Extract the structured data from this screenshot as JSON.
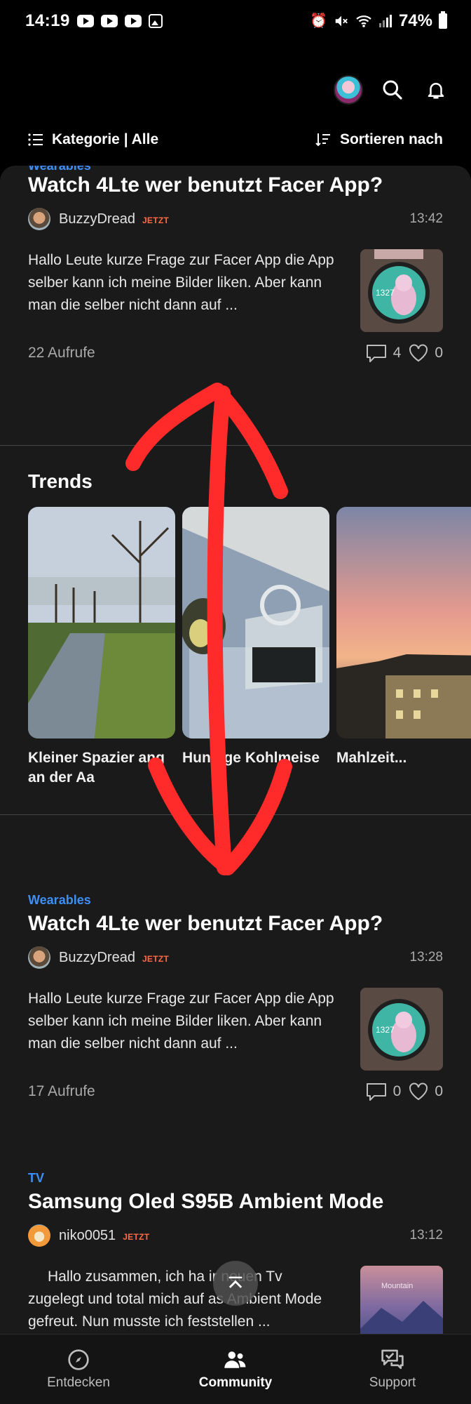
{
  "status_bar": {
    "time": "14:19",
    "battery": "74%"
  },
  "filter": {
    "category_label": "Kategorie | Alle",
    "sort_label": "Sortieren nach"
  },
  "posts": [
    {
      "category": "Wearables",
      "title": "Watch 4Lte wer benutzt Facer App?",
      "author": "BuzzyDread",
      "badge": "JETZT",
      "time": "13:42",
      "excerpt": "Hallo Leute kurze Frage zur Facer App die App selber kann ich meine Bilder liken. Aber kann man die selber nicht dann auf ...",
      "views": "22 Aufrufe",
      "comments": "4",
      "likes": "0"
    },
    {
      "category": "Wearables",
      "title": "Watch 4Lte wer benutzt Facer App?",
      "author": "BuzzyDread",
      "badge": "JETZT",
      "time": "13:28",
      "excerpt": "Hallo Leute kurze Frage zur Facer App die App selber kann ich meine Bilder liken. Aber kann man die selber nicht dann auf ...",
      "views": "17 Aufrufe",
      "comments": "0",
      "likes": "0"
    },
    {
      "category": "TV",
      "title": "Samsung Oled S95B Ambient Mode",
      "author": "niko0051",
      "badge": "JETZT",
      "time": "13:12",
      "excerpt": "Hallo zusammen, ich ha ir neuen Tv zugelegt und total mich auf as Ambient Mode gefreut. Nun musste ich feststellen ..."
    }
  ],
  "trends": {
    "title": "Trends",
    "items": [
      {
        "label": "Kleiner Spazier ang an der Aa"
      },
      {
        "label": "Hung ge Kohlmeise"
      },
      {
        "label": "Mahlzeit..."
      }
    ]
  },
  "thumb_text": {
    "watch_time": "1327",
    "tv_text": "Mountain"
  },
  "bottom_nav": [
    {
      "label": "Entdecken",
      "icon": "compass-icon"
    },
    {
      "label": "Community",
      "icon": "people-icon"
    },
    {
      "label": "Support",
      "icon": "chat-support-icon"
    }
  ],
  "colors": {
    "accent": "#3e8ef7",
    "badge": "#ff6b45",
    "annotation": "#ff2a2a"
  }
}
